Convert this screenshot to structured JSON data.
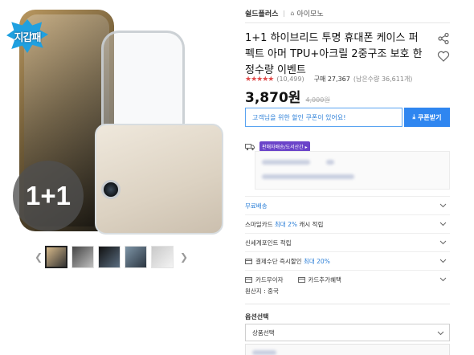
{
  "gallery": {
    "sticker_text": "지갑패",
    "badge_text": "1+1",
    "thumbs": [
      "thumb-1",
      "thumb-2",
      "thumb-3",
      "thumb-4",
      "thumb-5"
    ],
    "prev_icon": "chevron-left-icon",
    "next_icon": "chevron-right-icon"
  },
  "header": {
    "brand": "쉴드플러스",
    "store_label": "아이모노"
  },
  "product": {
    "title": "1+1 하이브리드 투명 휴대폰 케이스 퍼펙트 아머 TPU+아크릴 2중구조 보호 한정수량 이벤트",
    "rating_count": "(10,499)",
    "sold": "구매 27,367",
    "wish": "(남은수량 36,611개)",
    "price": "3,870원",
    "original_price": "4,000원",
    "stars": "★★★★★"
  },
  "coupon": {
    "message": "고객님을 위한 할인 쿠폰이 있어요!",
    "button_label": "쿠폰받기"
  },
  "shipping": {
    "badge": "판매자배송/도서산간 ▸"
  },
  "options": [
    {
      "label": "무료배송",
      "highlight": ""
    },
    {
      "label": "스마일카드 최대 2% 캐시 적립",
      "highlight": ""
    },
    {
      "label": "신세계포인트 적립",
      "highlight": ""
    },
    {
      "label": "결제수단 즉시할인 최대 20%",
      "highlight": ""
    }
  ],
  "extra": {
    "card_interest": "카드무이자",
    "card_benefit": "카드추가혜택"
  },
  "origin": "원산지 : 중국",
  "option_section": {
    "title": "옵션선택",
    "select_placeholder": "상품선택"
  }
}
